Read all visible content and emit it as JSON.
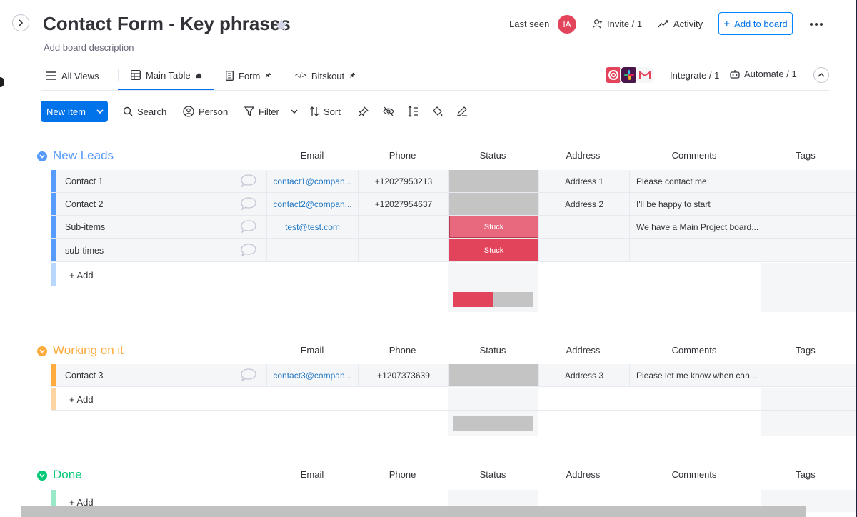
{
  "board": {
    "title": "Contact Form - Key phrases",
    "description": "Add board description"
  },
  "header": {
    "last_seen_label": "Last seen",
    "avatar_initials": "IA",
    "invite_label": "Invite / 1",
    "activity_label": "Activity",
    "add_to_board_label": "Add to board"
  },
  "tabs": {
    "all_views": "All Views",
    "main_table": "Main Table",
    "form": "Form",
    "bitskout": "Bitskout",
    "integrate": "Integrate / 1",
    "automate": "Automate / 1"
  },
  "toolbar": {
    "new_item": "New Item",
    "search": "Search",
    "person": "Person",
    "filter": "Filter",
    "sort": "Sort"
  },
  "columns": {
    "email": "Email",
    "phone": "Phone",
    "status": "Status",
    "address": "Address",
    "comments": "Comments",
    "tags": "Tags"
  },
  "add_label": "+ Add",
  "colors": {
    "primary": "#0073ea",
    "new_leads": "#579bfc",
    "working_on_it": "#fdab3d",
    "done": "#00c875",
    "stuck": "#e2445c",
    "stuck_light": "#e8697d",
    "status_empty": "#c4c4c4"
  },
  "groups": [
    {
      "name": "New Leads",
      "rows": [
        {
          "name": "Contact 1",
          "email": "contact1@compan...",
          "phone": "+12027953213",
          "status": "",
          "address": "Address 1",
          "comments": "Please contact me"
        },
        {
          "name": "Contact 2",
          "email": "contact2@compan...",
          "phone": "+12027954637",
          "status": "",
          "address": "Address 2",
          "comments": "I'll be happy to start"
        },
        {
          "name": "Sub-items",
          "email": "test@test.com",
          "phone": "",
          "status": "Stuck",
          "address": "",
          "comments": "We have a Main Project board..."
        },
        {
          "name": "sub-times",
          "email": "",
          "phone": "",
          "status": "Stuck",
          "address": "",
          "comments": ""
        }
      ],
      "status_summary_stuck_fraction": 0.5
    },
    {
      "name": "Working on it",
      "rows": [
        {
          "name": "Contact 3",
          "email": "contact3@compan...",
          "phone": "+1207373639",
          "status": "",
          "address": "Address 3",
          "comments": "Please let me know when can..."
        }
      ],
      "status_summary_stuck_fraction": 0
    },
    {
      "name": "Done",
      "rows": []
    }
  ]
}
